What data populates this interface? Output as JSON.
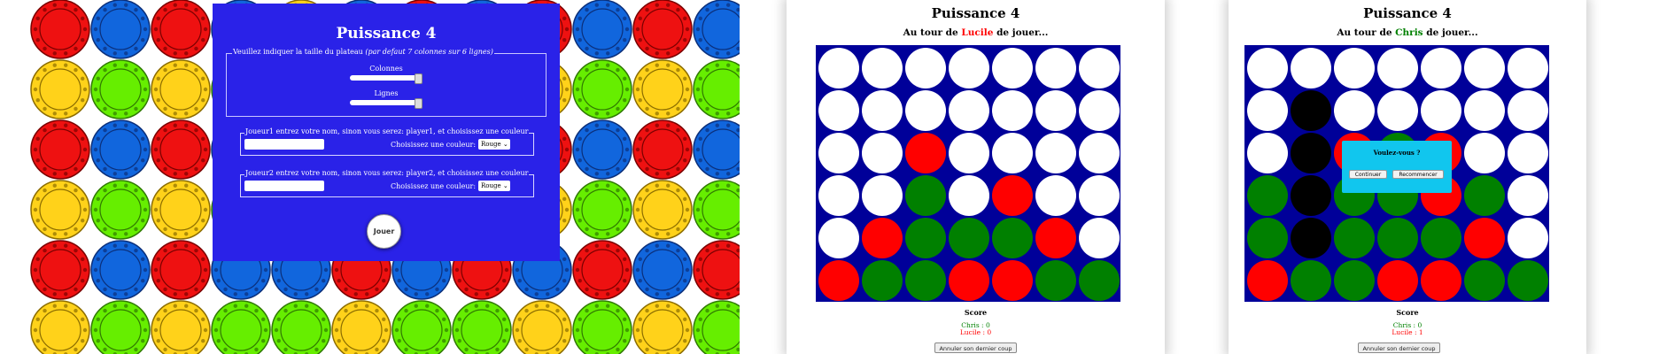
{
  "colors": {
    "red": "#ff0000",
    "green": "#008000",
    "white": "#ffffff",
    "black": "#000000",
    "board_blue": "#000099",
    "setup_blue": "#2a22e8",
    "modal_cyan": "#11c6ee"
  },
  "setup": {
    "title": "Puissance 4",
    "board_legend": "Veuillez indiquer la taille du plateau",
    "board_legend_default": "(par defaut 7 colonnes sur 6 lignes)",
    "columns_label": "Colonnes",
    "rows_label": "Lignes",
    "player1_legend": "Joueur1 entrez votre nom, sinon vous serez: player1, et choisissez une couleur",
    "player2_legend": "Joueur2 entrez votre nom, sinon vous serez: player2, et choisissez une couleur",
    "color_label": "Choisissez une couleur:",
    "player1_color": "Rouge",
    "player2_color": "Rouge",
    "play_button": "Jouer"
  },
  "game1": {
    "title": "Puissance 4",
    "turn_prefix": "Au tour de",
    "turn_player": "Lucile",
    "turn_suffix": "de jouer...",
    "board": [
      "WWWWWWW",
      "WWWWWWW",
      "WWRWWWW",
      "WWGWRWW",
      "WRGGGRW",
      "RGGRRGG"
    ],
    "score_title": "Score",
    "score_chris": "Chris : 0",
    "score_lucile": "Lucile : 0",
    "undo_button": "Annuler son dernier coup"
  },
  "game2": {
    "title": "Puissance 4",
    "turn_prefix": "Au tour de",
    "turn_player": "Chris",
    "turn_suffix": "de jouer...",
    "board": [
      "WWWWWWW",
      "WBWWWWW",
      "WBRGRWW",
      "GBGGRGW",
      "GBGGGRW",
      "RGGRRGG"
    ],
    "score_title": "Score",
    "score_chris": "Chris : 0",
    "score_lucile": "Lucile : 1",
    "undo_button": "Annuler son dernier coup",
    "modal": {
      "title": "Voulez-vous ?",
      "continue_button": "Continuer",
      "restart_button": "Recommencer"
    }
  }
}
